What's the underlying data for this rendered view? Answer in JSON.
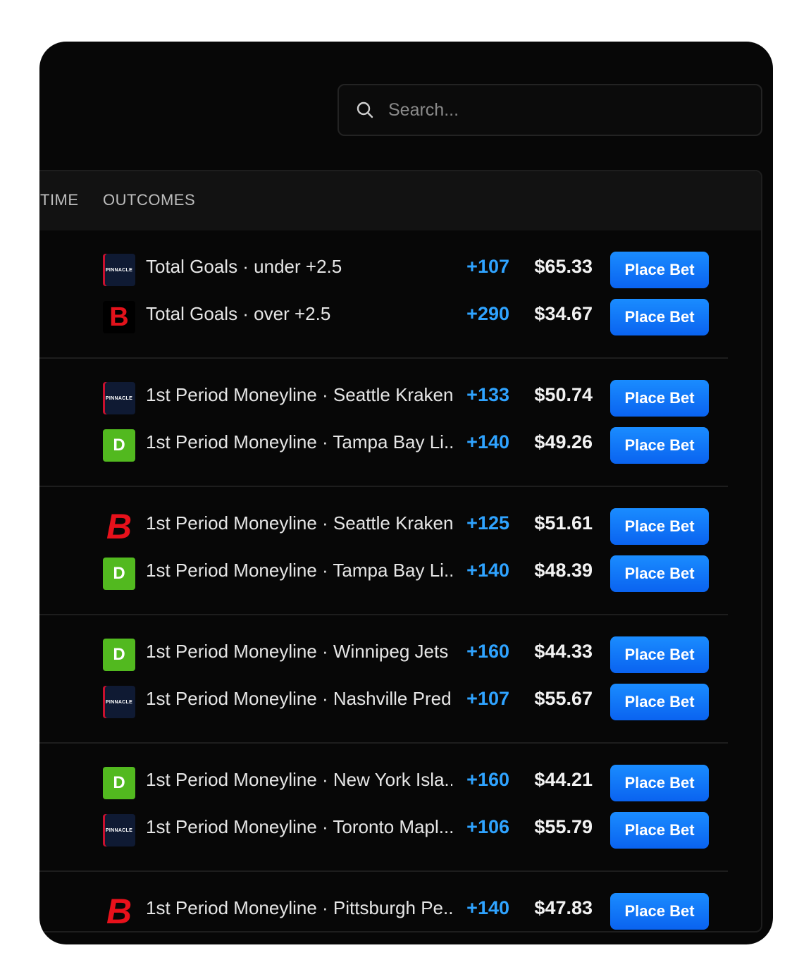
{
  "search": {
    "placeholder": "Search..."
  },
  "table": {
    "columns": {
      "time": "TIME",
      "outcomes": "OUTCOMES"
    },
    "groups": [
      {
        "rows": [
          {
            "book": "pinnacle",
            "book_label": "PINNACLE",
            "outcome": "Total Goals · under +2.5",
            "odds": "+107",
            "stake": "$65.33",
            "button": "Place Bet"
          },
          {
            "book": "betonline",
            "book_label": "B",
            "outcome": "Total Goals · over +2.5",
            "odds": "+290",
            "stake": "$34.67",
            "button": "Place Bet"
          }
        ]
      },
      {
        "rows": [
          {
            "book": "pinnacle",
            "book_label": "PINNACLE",
            "outcome": "1st Period Moneyline · Seattle Kraken",
            "odds": "+133",
            "stake": "$50.74",
            "button": "Place Bet"
          },
          {
            "book": "draftkings",
            "book_label": "D",
            "outcome": "1st Period Moneyline · Tampa Bay Li...",
            "odds": "+140",
            "stake": "$49.26",
            "button": "Place Bet"
          }
        ]
      },
      {
        "rows": [
          {
            "book": "bet365",
            "book_label": "B",
            "outcome": "1st Period Moneyline · Seattle Kraken",
            "odds": "+125",
            "stake": "$51.61",
            "button": "Place Bet"
          },
          {
            "book": "draftkings",
            "book_label": "D",
            "outcome": "1st Period Moneyline · Tampa Bay Li...",
            "odds": "+140",
            "stake": "$48.39",
            "button": "Place Bet"
          }
        ]
      },
      {
        "rows": [
          {
            "book": "draftkings",
            "book_label": "D",
            "outcome": "1st Period Moneyline · Winnipeg Jets",
            "odds": "+160",
            "stake": "$44.33",
            "button": "Place Bet"
          },
          {
            "book": "pinnacle",
            "book_label": "PINNACLE",
            "outcome": "1st Period Moneyline · Nashville Pred...",
            "odds": "+107",
            "stake": "$55.67",
            "button": "Place Bet"
          }
        ]
      },
      {
        "rows": [
          {
            "book": "draftkings",
            "book_label": "D",
            "outcome": "1st Period Moneyline · New York Isla...",
            "odds": "+160",
            "stake": "$44.21",
            "button": "Place Bet"
          },
          {
            "book": "pinnacle",
            "book_label": "PINNACLE",
            "outcome": "1st Period Moneyline · Toronto Mapl...",
            "odds": "+106",
            "stake": "$55.79",
            "button": "Place Bet"
          }
        ]
      },
      {
        "rows": [
          {
            "book": "bet365",
            "book_label": "B",
            "outcome": "1st Period Moneyline · Pittsburgh Pe...",
            "odds": "+140",
            "stake": "$47.83",
            "button": "Place Bet"
          }
        ]
      }
    ]
  },
  "colors": {
    "accent": "#1a8cff",
    "odds": "#2fa3ff",
    "background": "#070707"
  }
}
